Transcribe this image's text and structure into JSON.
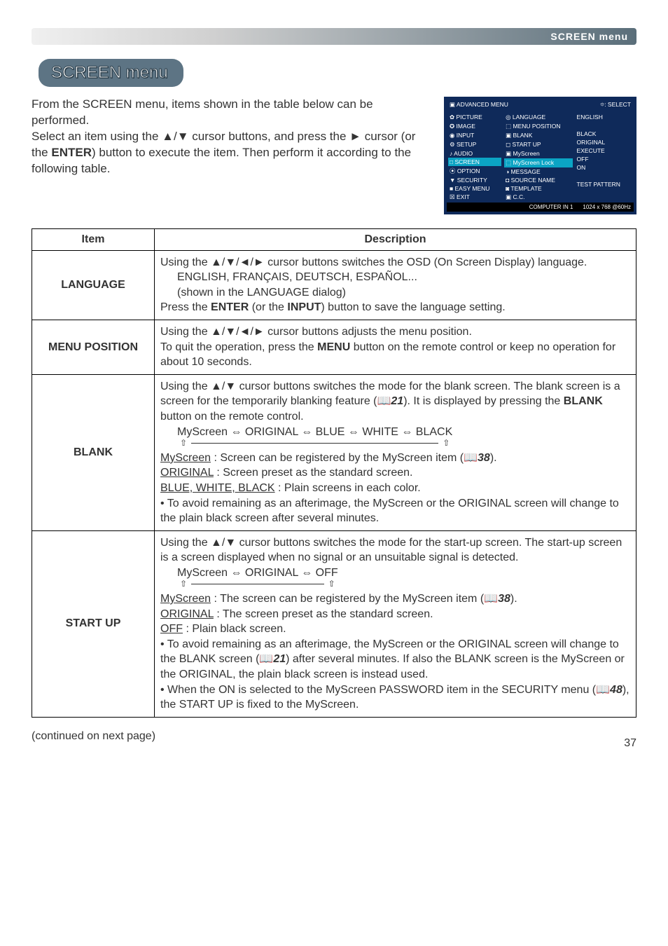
{
  "breadcrumb": "SCREEN menu",
  "section_title": "SCREEN menu",
  "intro": "From the SCREEN menu, items shown in the table below can be performed.\nSelect an item using the ▲/▼ cursor buttons, and press the ► cursor (or the ENTER) button to execute the item. Then perform it according to the following table.",
  "menu_panel": {
    "header_left": "▣ ADVANCED MENU",
    "header_right": "⯐: SELECT",
    "left_items": [
      "✿ PICTURE",
      "✪ IMAGE",
      "◉ INPUT",
      "⚙ SETUP",
      "♪ AUDIO",
      "□ SCREEN",
      "⦿ OPTION",
      "▼ SECURITY",
      "■ EASY MENU",
      "☒ EXIT"
    ],
    "mid_items": [
      "◎ LANGUAGE",
      "⬚ MENU POSITION",
      "▣ BLANK",
      "◻ START UP",
      "▣ MyScreen",
      "⬚ MyScreen Lock",
      "◑ MESSAGE",
      "◘ SOURCE NAME",
      "◙ TEMPLATE",
      "▣ C.C."
    ],
    "right_items": [
      "ENGLISH",
      "",
      "BLACK",
      "ORIGINAL",
      "EXECUTE",
      "OFF",
      "ON",
      "",
      "TEST PATTERN",
      ""
    ],
    "hl_left_index": 5,
    "hl_mid_index": 5,
    "footer_left": "COMPUTER IN 1",
    "footer_right": "1024 x 768 @60Hz"
  },
  "table": {
    "header_item": "Item",
    "header_desc": "Description",
    "rows": [
      {
        "item": "LANGUAGE",
        "desc_lines": [
          "Using the ▲/▼/◄/► cursor buttons switches the OSD (On Screen Display) language.",
          {
            "indent": true,
            "text": "ENGLISH, FRANÇAIS, DEUTSCH, ESPAÑOL..."
          },
          {
            "indent": true,
            "text": "(shown in the LANGUAGE dialog)"
          },
          "Press the <b>ENTER</b> (or the <b>INPUT</b>) button to save the language setting."
        ]
      },
      {
        "item": "MENU POSITION",
        "desc_lines": [
          "Using the ▲/▼/◄/► cursor buttons adjusts the menu position.",
          "To quit the operation, press the <b>MENU</b> button on the remote control or keep no operation for about 10 seconds."
        ]
      },
      {
        "item": "BLANK",
        "desc_lines": [
          "Using the ▲/▼ cursor buttons switches the mode for the blank screen. The blank screen is a screen for the temporarily blanking feature (📖<i><b>21</b></i>). It is displayed by pressing the <b>BLANK</b> button on the remote control.",
          {
            "cycle": "MyScreen ⇔ ORIGINAL ⇔ BLUE ⇔ WHITE ⇔ BLACK"
          },
          "<span class='ul'>MyScreen</span> : Screen can be registered by the MyScreen item (📖<i><b>38</b></i>).",
          "<span class='ul'>ORIGINAL</span> : Screen preset as the standard screen.",
          "<span class='ul'>BLUE, WHITE, BLACK</span> : Plain screens in each color.",
          "• To avoid remaining as an afterimage, the MyScreen or the ORIGINAL screen will change to the plain black screen after several minutes."
        ]
      },
      {
        "item": "START UP",
        "desc_lines": [
          "Using the ▲/▼ cursor buttons switches the mode for the start-up screen. The start-up screen is a screen displayed when no signal or an unsuitable signal is detected.",
          {
            "cycle": "MyScreen ⇔ ORIGINAL ⇔ OFF"
          },
          "<span class='ul'>MyScreen</span> : The screen can be registered by the MyScreen item (📖<i><b>38</b></i>).",
          "<span class='ul'>ORIGINAL</span> : The screen preset as the standard screen.",
          "<span class='ul'>OFF</span> : Plain black screen.",
          "• To avoid remaining as an afterimage, the MyScreen or the ORIGINAL screen will change to the BLANK screen (📖<i><b>21</b></i>) after several minutes. If also the BLANK screen is the MyScreen or the ORIGINAL, the plain black screen is instead used.",
          "• When the ON is selected to the MyScreen PASSWORD item in the SECURITY menu (📖<i><b>48</b></i>), the START UP is fixed to the MyScreen."
        ]
      }
    ]
  },
  "continued": "(continued on next page)",
  "page_number": "37"
}
